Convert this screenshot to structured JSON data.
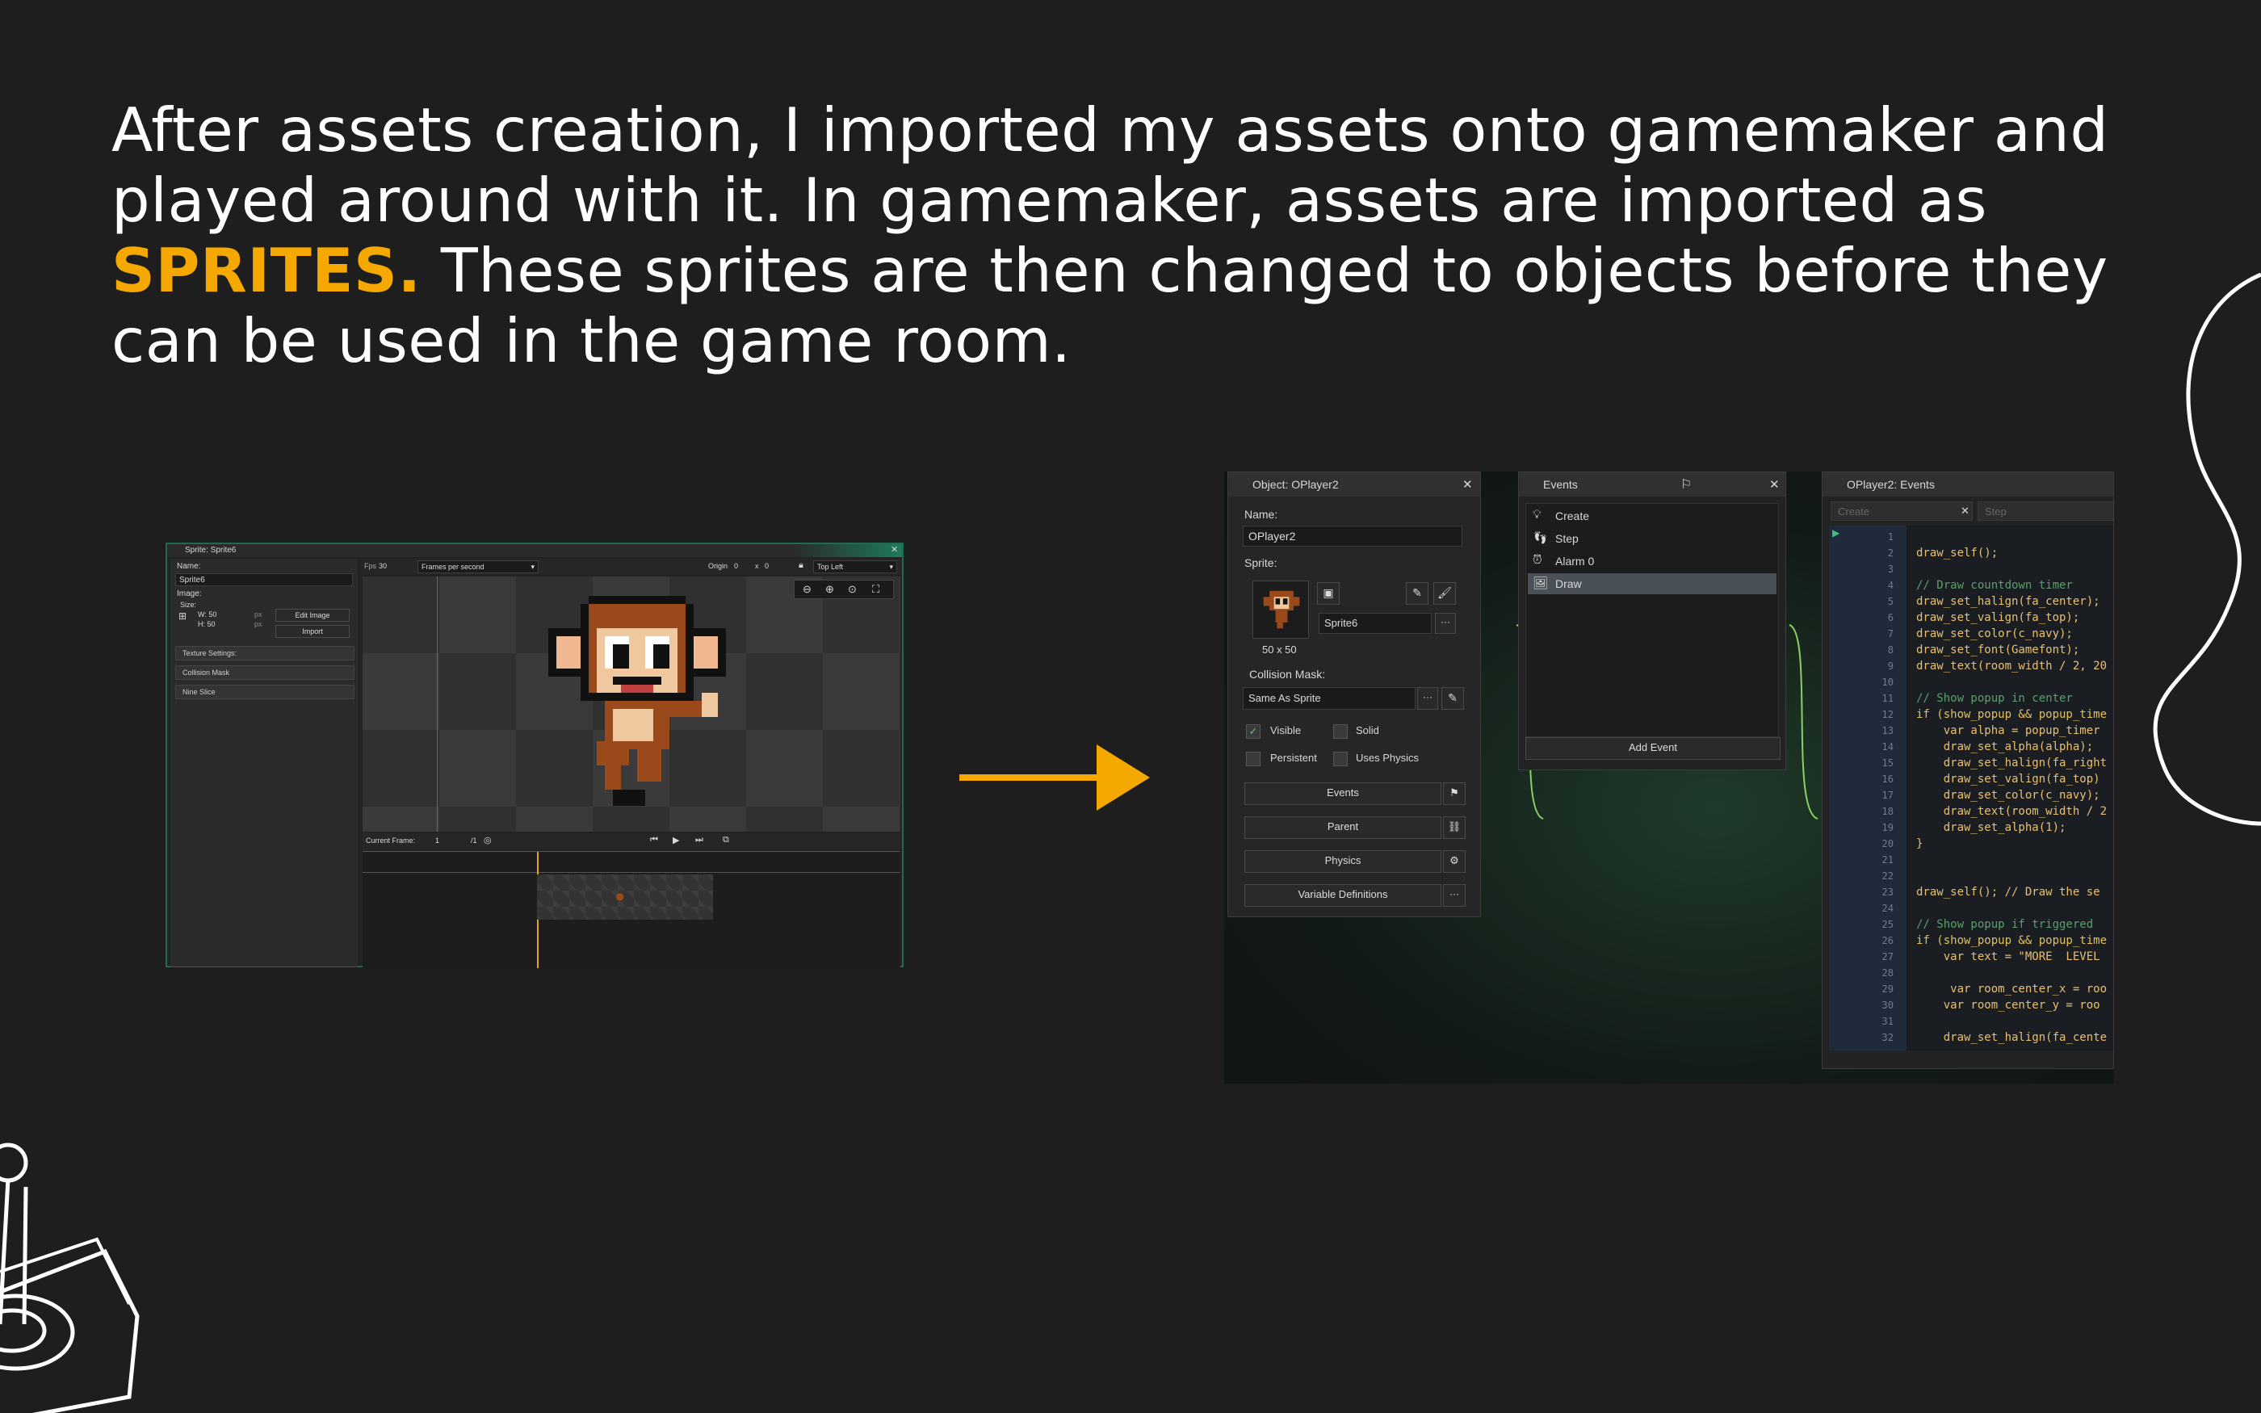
{
  "slide": {
    "text_before": "After assets creation, I imported my assets onto gamemaker and played around with it. In gamemaker, assets are imported as ",
    "highlight": "SPRITES.",
    "text_after": " These sprites are then changed to objects before they can be used in the game room.",
    "accent_color": "#f5a800",
    "background": "#1e1e1e"
  },
  "sprite_editor": {
    "title": "Sprite: Sprite6",
    "name_label": "Name:",
    "name_value": "Sprite6",
    "image_label": "Image:",
    "size_label": "Size:",
    "width": "W: 50",
    "height": "H: 50",
    "unit_w": "px",
    "unit_h": "px",
    "edit_image": "Edit Image",
    "import": "Import",
    "sections": [
      "Texture Settings:",
      "Collision Mask",
      "Nine Slice"
    ],
    "fps_label": "Fps",
    "fps_value": "30",
    "fps_mode": "Frames per second",
    "origin_label": "Origin",
    "origin_x": "0",
    "origin_sep": "x",
    "origin_y": "0",
    "origin_preset": "Top Left",
    "current_frame_label": "Current Frame:",
    "current_frame_value": "1",
    "frame_total": "/1"
  },
  "object_panel": {
    "title": "Object: OPlayer2",
    "name_label": "Name:",
    "name_value": "OPlayer2",
    "sprite_label": "Sprite:",
    "sprite_value": "Sprite6",
    "sprite_size": "50 x 50",
    "collision_label": "Collision Mask:",
    "collision_value": "Same As Sprite",
    "visible": "Visible",
    "solid": "Solid",
    "persistent": "Persistent",
    "uses_physics": "Uses Physics",
    "buttons": [
      "Events",
      "Parent",
      "Physics",
      "Variable Definitions"
    ]
  },
  "events_panel": {
    "title": "Events",
    "items": [
      "Create",
      "Step",
      "Alarm 0",
      "Draw"
    ],
    "selected": "Draw",
    "add_event": "Add Event"
  },
  "code_panel": {
    "title": "OPlayer2: Events",
    "tabs": [
      "Create",
      "Step"
    ],
    "lines": [
      {
        "n": "1",
        "code": ""
      },
      {
        "n": "2",
        "code": "draw_self();"
      },
      {
        "n": "3",
        "code": ""
      },
      {
        "n": "4",
        "code": "// Draw countdown timer"
      },
      {
        "n": "5",
        "code": "draw_set_halign(fa_center);"
      },
      {
        "n": "6",
        "code": "draw_set_valign(fa_top);"
      },
      {
        "n": "7",
        "code": "draw_set_color(c_navy);"
      },
      {
        "n": "8",
        "code": "draw_set_font(Gamefont);"
      },
      {
        "n": "9",
        "code": "draw_text(room_width / 2, 20"
      },
      {
        "n": "10",
        "code": ""
      },
      {
        "n": "11",
        "code": "// Show popup in center"
      },
      {
        "n": "12",
        "code": "if (show_popup && popup_time"
      },
      {
        "n": "13",
        "code": "    var alpha = popup_timer"
      },
      {
        "n": "14",
        "code": "    draw_set_alpha(alpha);"
      },
      {
        "n": "15",
        "code": "    draw_set_halign(fa_right"
      },
      {
        "n": "16",
        "code": "    draw_set_valign(fa_top)"
      },
      {
        "n": "17",
        "code": "    draw_set_color(c_navy);"
      },
      {
        "n": "18",
        "code": "    draw_text(room_width / 2"
      },
      {
        "n": "19",
        "code": "    draw_set_alpha(1);"
      },
      {
        "n": "20",
        "code": "}"
      },
      {
        "n": "21",
        "code": ""
      },
      {
        "n": "22",
        "code": ""
      },
      {
        "n": "23",
        "code": "draw_self(); // Draw the se"
      },
      {
        "n": "24",
        "code": ""
      },
      {
        "n": "25",
        "code": "// Show popup if triggered"
      },
      {
        "n": "26",
        "code": "if (show_popup && popup_time"
      },
      {
        "n": "27",
        "code": "    var text = \"MORE  LEVEL"
      },
      {
        "n": "28",
        "code": ""
      },
      {
        "n": "29",
        "code": "     var room_center_x = roo"
      },
      {
        "n": "30",
        "code": "    var room_center_y = roo"
      },
      {
        "n": "31",
        "code": ""
      },
      {
        "n": "32",
        "code": "    draw_set_halign(fa_cente"
      }
    ]
  }
}
